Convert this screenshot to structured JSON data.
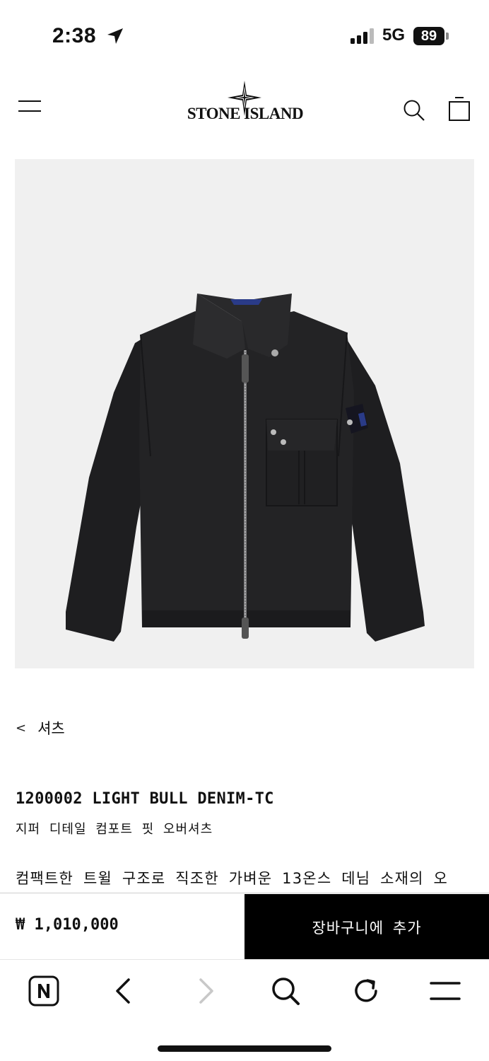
{
  "status_bar": {
    "time": "2:38",
    "network": "5G",
    "battery": "89"
  },
  "header": {
    "brand": "STONE ISLAND",
    "icons": [
      "menu-icon",
      "search-icon",
      "shopping-bag-icon"
    ]
  },
  "breadcrumb": {
    "label": "셔츠"
  },
  "product": {
    "title": "1200002 LIGHT BULL DENIM-TC",
    "subtitle": "지퍼 디테일 컴포트 핏 오버셔츠",
    "description": "컴팩트한 트윌 구조로 직조한 가벼운 13온스 데님 소재의 오"
  },
  "purchase": {
    "price": "₩ 1,010,000",
    "add_to_cart_label": "장바구니에 추가"
  },
  "browser_toolbar": {
    "icons": [
      "naver-home-icon",
      "back-icon",
      "forward-icon",
      "search-icon",
      "reload-icon",
      "menu-icon"
    ]
  },
  "colors": {
    "button_bg": "#000000",
    "image_bg": "#f0f0f0",
    "jacket": "#1f1f21"
  }
}
